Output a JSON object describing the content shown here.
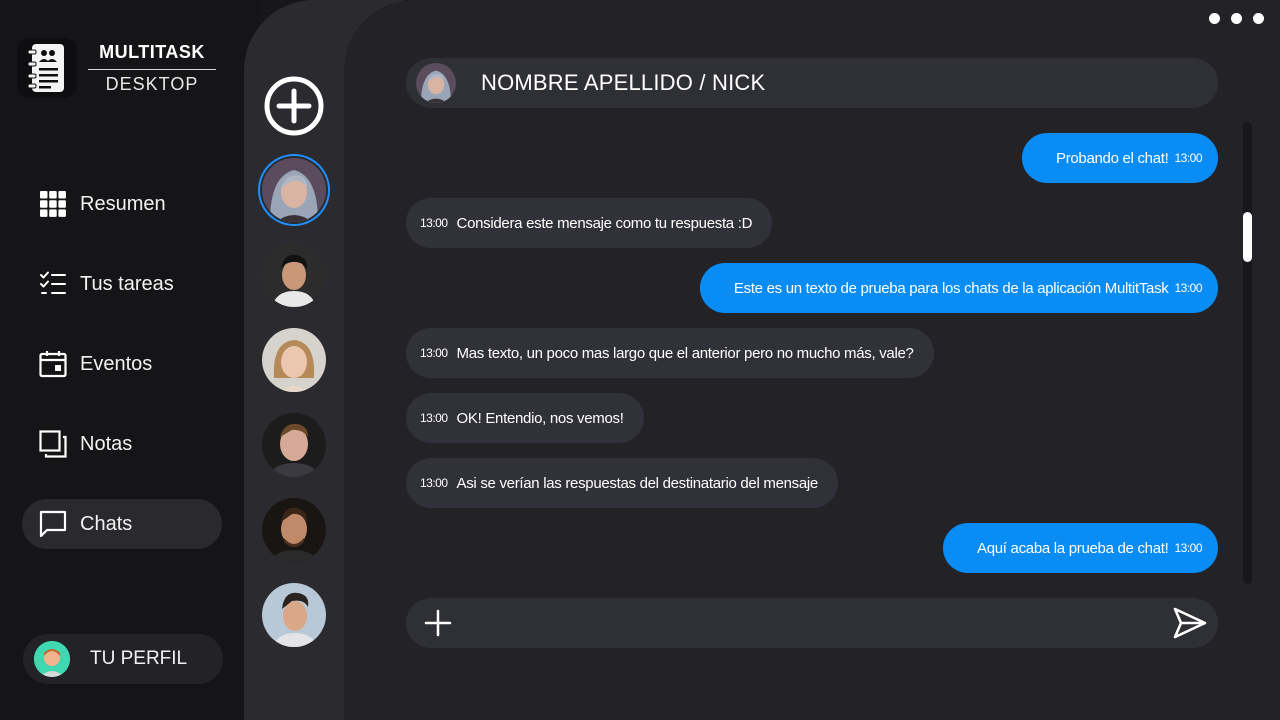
{
  "brand": {
    "title": "MULTITASK",
    "subtitle": "DESKTOP"
  },
  "nav": [
    {
      "label": "Resumen",
      "icon": "grid-icon"
    },
    {
      "label": "Tus tareas",
      "icon": "checklist-icon"
    },
    {
      "label": "Eventos",
      "icon": "calendar-icon"
    },
    {
      "label": "Notas",
      "icon": "notes-icon"
    },
    {
      "label": "Chats",
      "icon": "chat-icon",
      "active": true
    }
  ],
  "profile": {
    "label": "TU PERFIL"
  },
  "chat": {
    "name": "NOMBRE APELLIDO / NICK",
    "messages": [
      {
        "dir": "out",
        "text": "Probando el chat!",
        "time": "13:00"
      },
      {
        "dir": "in",
        "text": "Considera este mensaje como tu respuesta :D",
        "time": "13:00"
      },
      {
        "dir": "out",
        "text": "Este es un texto de prueba para los chats de la aplicación MultitTask",
        "time": "13:00"
      },
      {
        "dir": "in",
        "text": "Mas texto, un poco mas largo que el anterior pero no mucho más, vale?",
        "time": "13:00"
      },
      {
        "dir": "in",
        "text": "OK! Entendio, nos vemos!",
        "time": "13:00"
      },
      {
        "dir": "in",
        "text": "Asi se verían las respuestas del destinatario del mensaje",
        "time": "13:00"
      },
      {
        "dir": "out",
        "text": "Aquí acaba la prueba de chat!",
        "time": "13:00"
      }
    ]
  },
  "composer": {
    "value": "",
    "placeholder": ""
  },
  "colors": {
    "accent": "#0a8cf5",
    "background": "#222227",
    "bubble_in": "#31313a",
    "sidebar": "#151517"
  }
}
